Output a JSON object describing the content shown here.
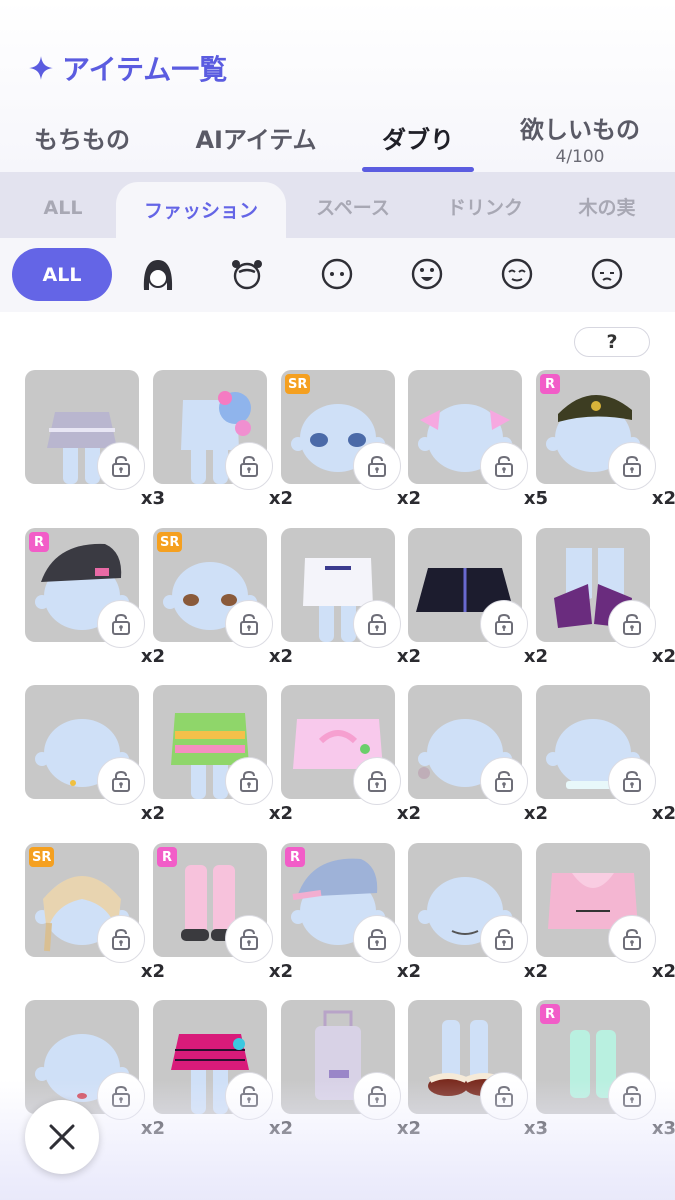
{
  "header": {
    "title": "アイテム一覧",
    "title_icon": "sparkle-icon",
    "accent_color": "#5b5ce0"
  },
  "tabs": [
    {
      "label": "もちもの",
      "sub": "",
      "active": false
    },
    {
      "label": "AIアイテム",
      "sub": "",
      "active": false
    },
    {
      "label": "ダブり",
      "sub": "",
      "active": true
    },
    {
      "label": "欲しいもの",
      "sub": "4/100",
      "active": false
    }
  ],
  "categories": [
    {
      "label": "ALL",
      "active": false
    },
    {
      "label": "ファッション",
      "active": true
    },
    {
      "label": "スペース",
      "active": false
    },
    {
      "label": "ドリンク",
      "active": false
    },
    {
      "label": "木の実",
      "active": false
    }
  ],
  "part_filters": {
    "all_label": "ALL",
    "icons": [
      "hair-icon",
      "head-accessory-icon",
      "face-icon",
      "mouth-icon",
      "eyes-icon",
      "expression-icon"
    ]
  },
  "help_label": "?",
  "items": [
    {
      "name": "frilled-skirt",
      "qty": "x3",
      "badge": ""
    },
    {
      "name": "blue-plush-backpack-outfit",
      "qty": "x2",
      "badge": ""
    },
    {
      "name": "sparkly-eyes",
      "qty": "x2",
      "badge": "SR"
    },
    {
      "name": "pink-ribbon-hair",
      "qty": "x5",
      "badge": ""
    },
    {
      "name": "military-cap",
      "qty": "x2",
      "badge": "R"
    },
    {
      "name": "black-cap",
      "qty": "x2",
      "badge": "R"
    },
    {
      "name": "brown-eyes",
      "qty": "x2",
      "badge": "SR"
    },
    {
      "name": "graphic-tee",
      "qty": "x2",
      "badge": ""
    },
    {
      "name": "china-jacket",
      "qty": "x2",
      "badge": ""
    },
    {
      "name": "purple-boots",
      "qty": "x2",
      "badge": ""
    },
    {
      "name": "small-earring",
      "qty": "x2",
      "badge": ""
    },
    {
      "name": "rainbow-hoodie",
      "qty": "x2",
      "badge": ""
    },
    {
      "name": "pink-rainbow-sweater",
      "qty": "x2",
      "badge": ""
    },
    {
      "name": "bow-hair-ties",
      "qty": "x2",
      "badge": ""
    },
    {
      "name": "choker",
      "qty": "x2",
      "badge": ""
    },
    {
      "name": "blonde-braid-hair",
      "qty": "x2",
      "badge": "SR"
    },
    {
      "name": "pink-leg-warmers",
      "qty": "x2",
      "badge": "R"
    },
    {
      "name": "denim-cap",
      "qty": "x2",
      "badge": "R"
    },
    {
      "name": "smile-mouth",
      "qty": "x2",
      "badge": ""
    },
    {
      "name": "pokeuni-hoodie",
      "qty": "x2",
      "badge": ""
    },
    {
      "name": "red-lips",
      "qty": "x2",
      "badge": ""
    },
    {
      "name": "plaid-skirt",
      "qty": "x2",
      "badge": ""
    },
    {
      "name": "suitcase",
      "qty": "x2",
      "badge": ""
    },
    {
      "name": "fur-sneakers",
      "qty": "x3",
      "badge": ""
    },
    {
      "name": "mint-socks",
      "qty": "x3",
      "badge": "R"
    }
  ],
  "close_icon": "close-icon",
  "colors": {
    "rarity_r": "#f25dc8",
    "rarity_sr": "#f5a020",
    "thumb_bg": "#c8c8c8",
    "avatar": "#cfe0f7"
  }
}
